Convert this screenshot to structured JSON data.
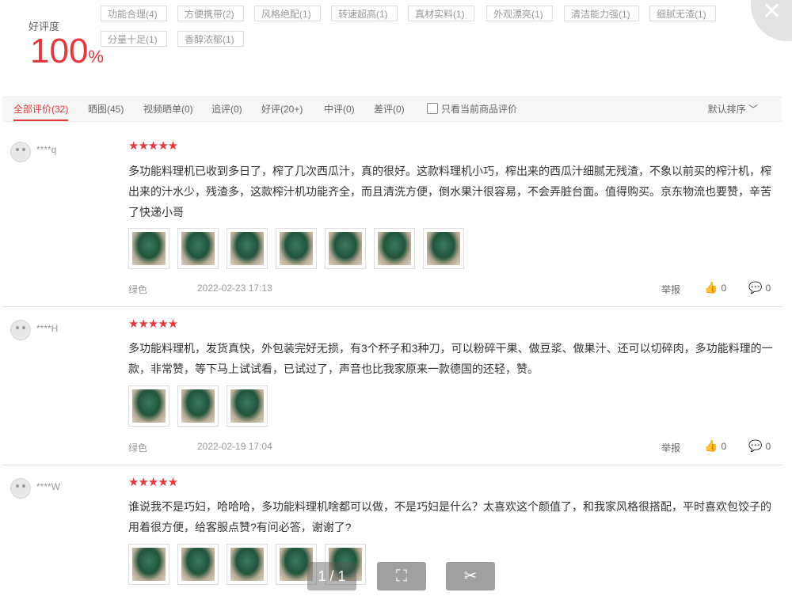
{
  "summary": {
    "label": "好评度",
    "percent": "100",
    "percent_sign": "%",
    "tags": [
      "功能合理(4)",
      "方便携带(2)",
      "风格绝配(1)",
      "转速超高(1)",
      "真材实料(1)",
      "外观漂亮(1)",
      "清洁能力强(1)",
      "细腻无渣(1)",
      "分量十足(1)",
      "香醇浓郁(1)"
    ]
  },
  "filters": {
    "items": [
      "全部评价(32)",
      "晒图(45)",
      "视频晒单(0)",
      "追评(0)",
      "好评(20+)",
      "中评(0)",
      "差评(0)"
    ],
    "current_only": "只看当前商品评价",
    "sort": "默认排序"
  },
  "reviews": [
    {
      "user": "****q",
      "stars": "★★★★★",
      "text": "多功能料理机已收到多日了，榨了几次西瓜汁，真的很好。这款料理机小巧，榨出来的西瓜汁细腻无残渣，不象以前买的榨汁机，榨出来的汁水少，残渣多，这款榨汁机功能齐全，而且清洗方便，倒水果汁很容易，不会弄脏台面。值得购买。京东物流也要赞，辛苦了快递小哥",
      "color": "绿色",
      "date": "2022-02-23 17:13",
      "report": "举报",
      "likes": "0",
      "comments": "0"
    },
    {
      "user": "****H",
      "stars": "★★★★★",
      "text": "多功能料理机，发货真快，外包装完好无损，有3个杯子和3种刀，可以粉碎干果、做豆浆、做果汁、还可以切碎肉，多功能料理的一款，非常赞，等下马上试试看，已试过了，声音也比我家原来一款德国的还轻，赞。",
      "color": "绿色",
      "date": "2022-02-19 17:04",
      "report": "举报",
      "likes": "0",
      "comments": "0"
    },
    {
      "user": "****W",
      "stars": "★★★★★",
      "text": "谁说我不是巧妇，哈哈哈，多功能料理机啥都可以做，不是巧妇是什么？太喜欢这个颜值了，和我家风格很搭配，平时喜欢包饺子的用着很方便，给客服点赞?有问必答，谢谢了?"
    }
  ],
  "viewer": {
    "page": "1 / 1",
    "fit_icon": "fit-screen-icon",
    "crop_icon": "crop-icon"
  },
  "colors": {
    "accent": "#e4393c"
  }
}
